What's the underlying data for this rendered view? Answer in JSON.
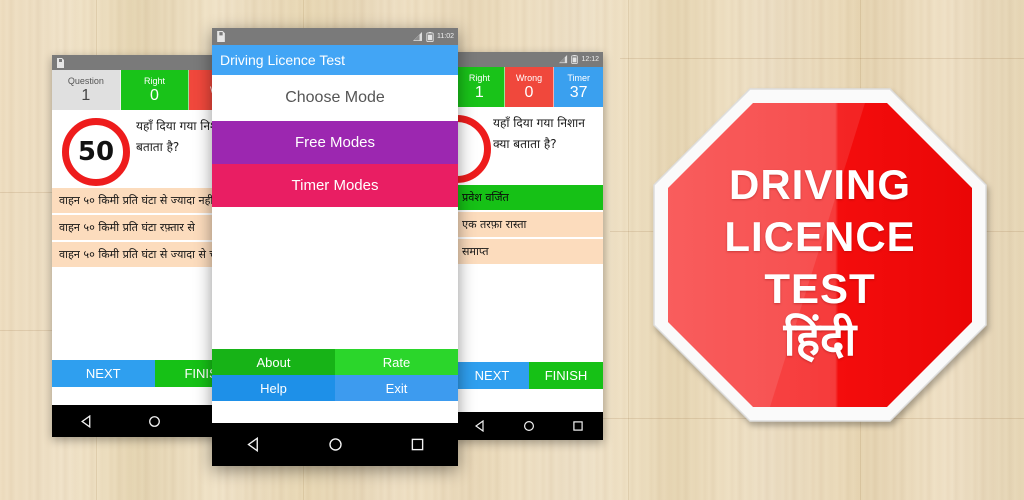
{
  "background": {
    "texture": "wood-plank",
    "base_color": "#efdfc2"
  },
  "left_phone": {
    "status": {
      "time": "",
      "icons": [
        "sd-card-icon"
      ]
    },
    "header": [
      {
        "label": "Question",
        "value": "1",
        "color": "#e0e0e0"
      },
      {
        "label": "Right",
        "value": "0",
        "color": "#19c319"
      },
      {
        "label": "Wrong",
        "value": "",
        "color": "#f0483c"
      }
    ],
    "sign_value": "50",
    "question": "यहाँ दिया गया निशान क्या बताता है?",
    "answers": [
      "वाहन ५० किमी प्रति घंटा से ज्यादा नहीं चलाये",
      "वाहन ५० किमी प्रति घंटा रफ़्तार से",
      "वाहन ५० किमी प्रति घंटा से ज्यादा से चलाये"
    ],
    "buttons": {
      "next": "NEXT",
      "finish": "FINISH"
    }
  },
  "center_phone": {
    "status": {
      "time": "11:02",
      "icons": [
        "sd-card-icon",
        "signal-icon",
        "battery-icon"
      ]
    },
    "appbar_title": "Driving Licence Test",
    "dialog_title": "Choose Mode",
    "modes": [
      {
        "label": "Free Modes",
        "color": "#9c27b0"
      },
      {
        "label": "Timer Modes",
        "color": "#e91e63"
      }
    ],
    "footer": [
      {
        "label": "About",
        "color": "#17b317"
      },
      {
        "label": "Rate",
        "color": "#2bd62b"
      },
      {
        "label": "Help",
        "color": "#1e90e8"
      },
      {
        "label": "Exit",
        "color": "#3d9bef"
      }
    ]
  },
  "right_phone": {
    "status": {
      "time": "12:12",
      "icons": [
        "signal-icon",
        "battery-icon"
      ]
    },
    "header": [
      {
        "label": "Right",
        "value": "1",
        "color": "#19c319"
      },
      {
        "label": "Wrong",
        "value": "0",
        "color": "#f0483c"
      },
      {
        "label": "Timer",
        "value": "37",
        "color": "#3aa0ef"
      }
    ],
    "question": "यहाँ दिया गया निशान क्या बताता है?",
    "answers": [
      {
        "text": "प्रवेश वर्जित",
        "state": "correct"
      },
      {
        "text": "एक तरफ़ा रास्ता",
        "state": "normal"
      },
      {
        "text": "समाप्त",
        "state": "normal"
      }
    ],
    "buttons": {
      "next": "NEXT",
      "finish": "FINISH"
    }
  },
  "logo": {
    "lines": [
      "DRIVING",
      "LICENCE",
      "TEST"
    ],
    "language_line": "हिंदी",
    "shape": "octagon-stop-sign",
    "fill_color": "#f01010",
    "border_color": "#f7f7f7"
  },
  "navbar": {
    "icons": [
      "back-icon",
      "home-icon",
      "recents-icon"
    ]
  }
}
